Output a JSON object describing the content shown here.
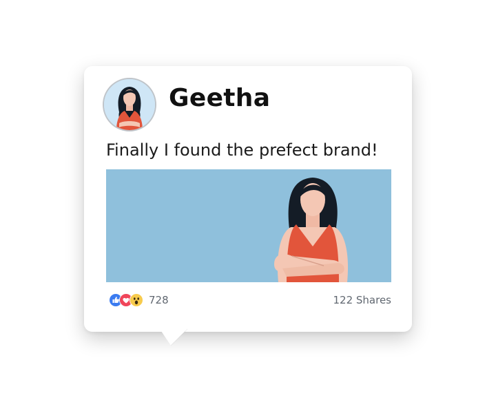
{
  "post": {
    "author": "Geetha",
    "text": "Finally I found the prefect brand!",
    "reaction_count": "728",
    "shares": "122 Shares",
    "reactions": [
      "like-icon",
      "love-icon",
      "wow-icon"
    ]
  },
  "colors": {
    "image_background": "#8fc0dc",
    "avatar_background": "#cfe6f6",
    "like": "#3b7bf0",
    "love": "#f0455a",
    "wow": "#f7cb4d",
    "dress": "#e2553b",
    "hair": "#141c26",
    "skin": "#f4c7b4"
  }
}
